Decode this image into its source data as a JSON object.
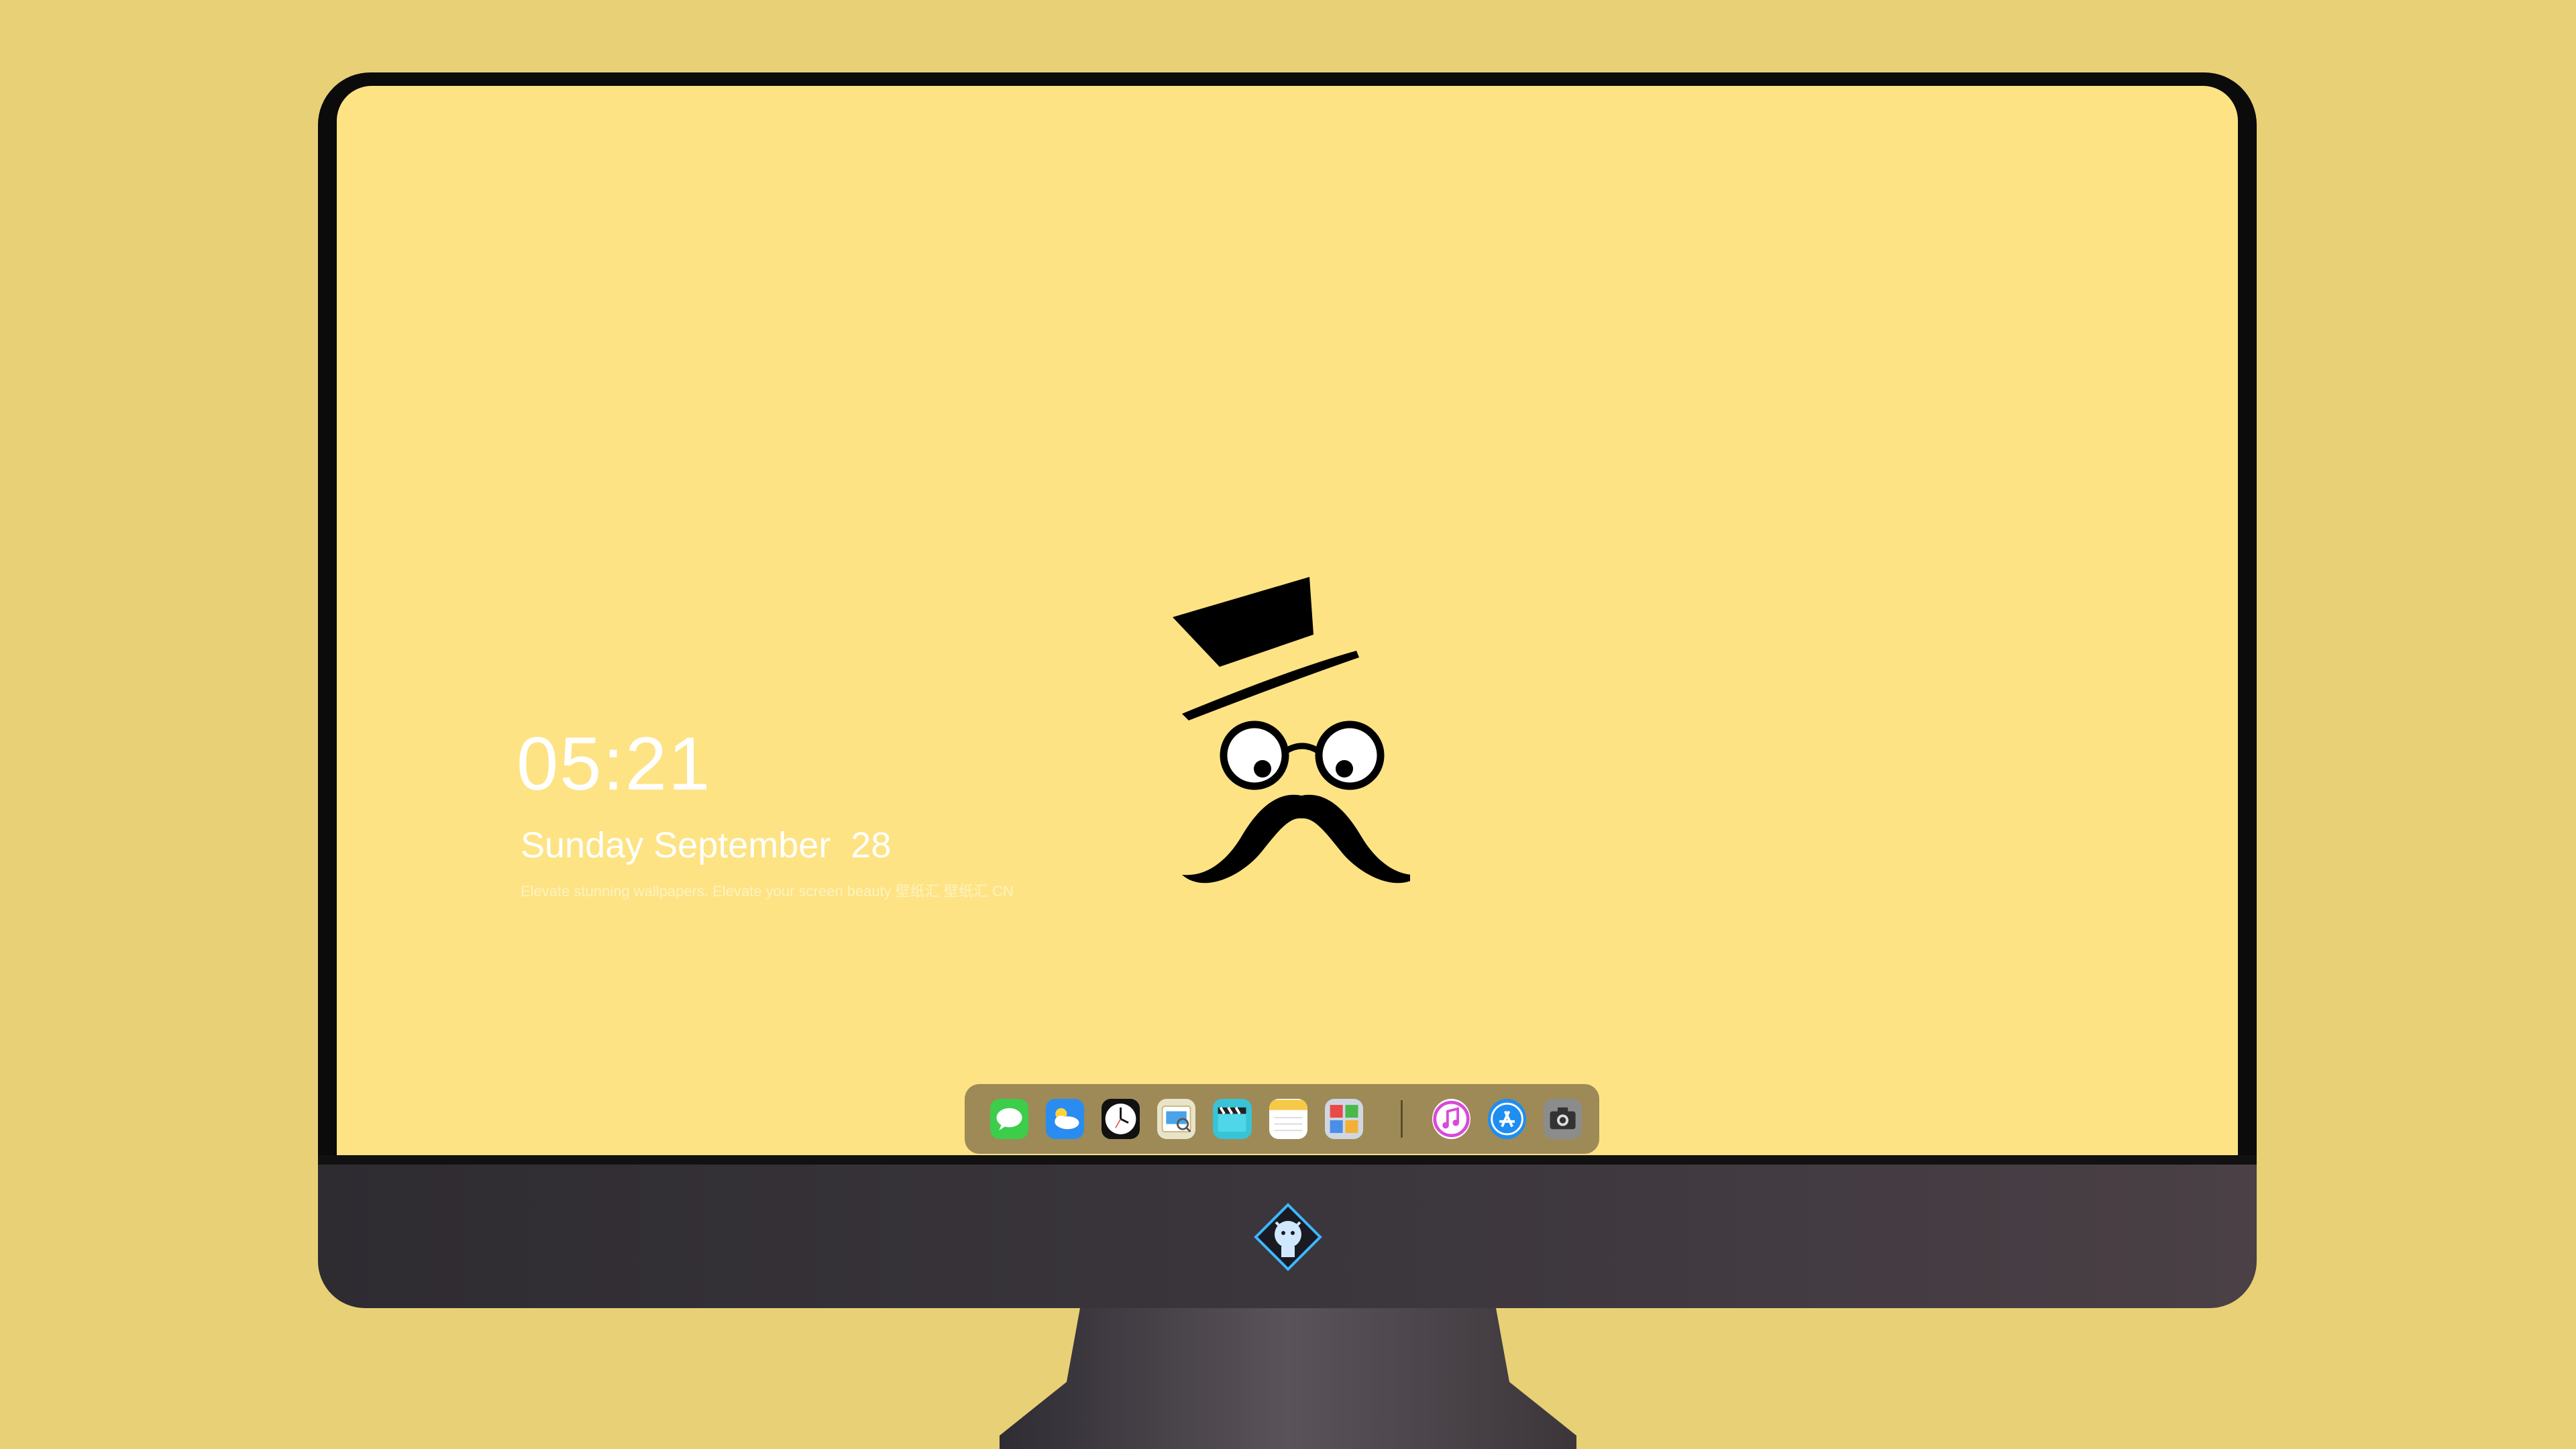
{
  "lock_screen": {
    "time": "05:21",
    "date": "Sunday September  28",
    "tagline": "Elevate stunning wallpapers. Elevate your screen beauty  壁纸汇  壁纸汇 CN"
  },
  "mascot": {
    "icon": "gentleman-mustache-icon"
  },
  "dock": {
    "apps": [
      {
        "name": "Messages",
        "icon": "messages-icon",
        "color": "#3ccd4a"
      },
      {
        "name": "Weather",
        "icon": "weather-icon",
        "color": "#2a8cf0"
      },
      {
        "name": "Clock",
        "icon": "clock-icon",
        "color": "#111111"
      },
      {
        "name": "Preview",
        "icon": "preview-icon",
        "color": "#e9e3c8"
      },
      {
        "name": "Clips",
        "icon": "clapperboard-icon",
        "color": "#39c3d6"
      },
      {
        "name": "Notes",
        "icon": "notes-icon",
        "color": "#f7c948"
      },
      {
        "name": "Photo Booth",
        "icon": "photo-booth-icon",
        "color": "#d0d7e2"
      },
      {
        "name": "iTunes",
        "icon": "music-icon",
        "color": "#d84ad8"
      },
      {
        "name": "App Store",
        "icon": "app-store-icon",
        "color": "#1e8ef0"
      },
      {
        "name": "Camera",
        "icon": "camera-icon",
        "color": "#8c8c8c"
      }
    ]
  },
  "colors": {
    "wallpaper": "#fde384",
    "background": "#e8d077",
    "bezel": "#0b0b0b",
    "dock": "#9d8a57"
  }
}
